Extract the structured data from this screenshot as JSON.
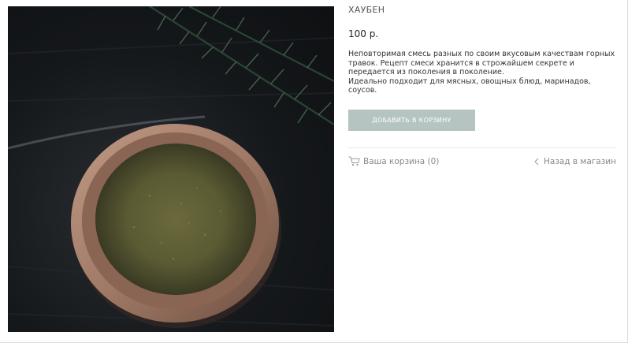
{
  "product": {
    "title": "ХАУБЕН",
    "price": "100 р.",
    "description": [
      "Неповторимая смесь разных по своим вкусовым качествам горных травок. Рецепт смеси хранится в строжайшем секрете и передается из поколения в поколение.",
      "Идеально подходит для мясных, овощных блюд, маринадов, соусов."
    ],
    "add_to_cart_label": "ДОБАВИТЬ В КОРЗИНУ"
  },
  "nav": {
    "cart_label": "Ваша корзина (0)",
    "back_label": "Назад в магазин"
  },
  "icons": {
    "cart": "cart-icon",
    "back": "chevron-left-icon"
  },
  "colors": {
    "button_bg": "#b5c4c0",
    "button_text": "#ffffff",
    "muted_text": "#888888"
  }
}
